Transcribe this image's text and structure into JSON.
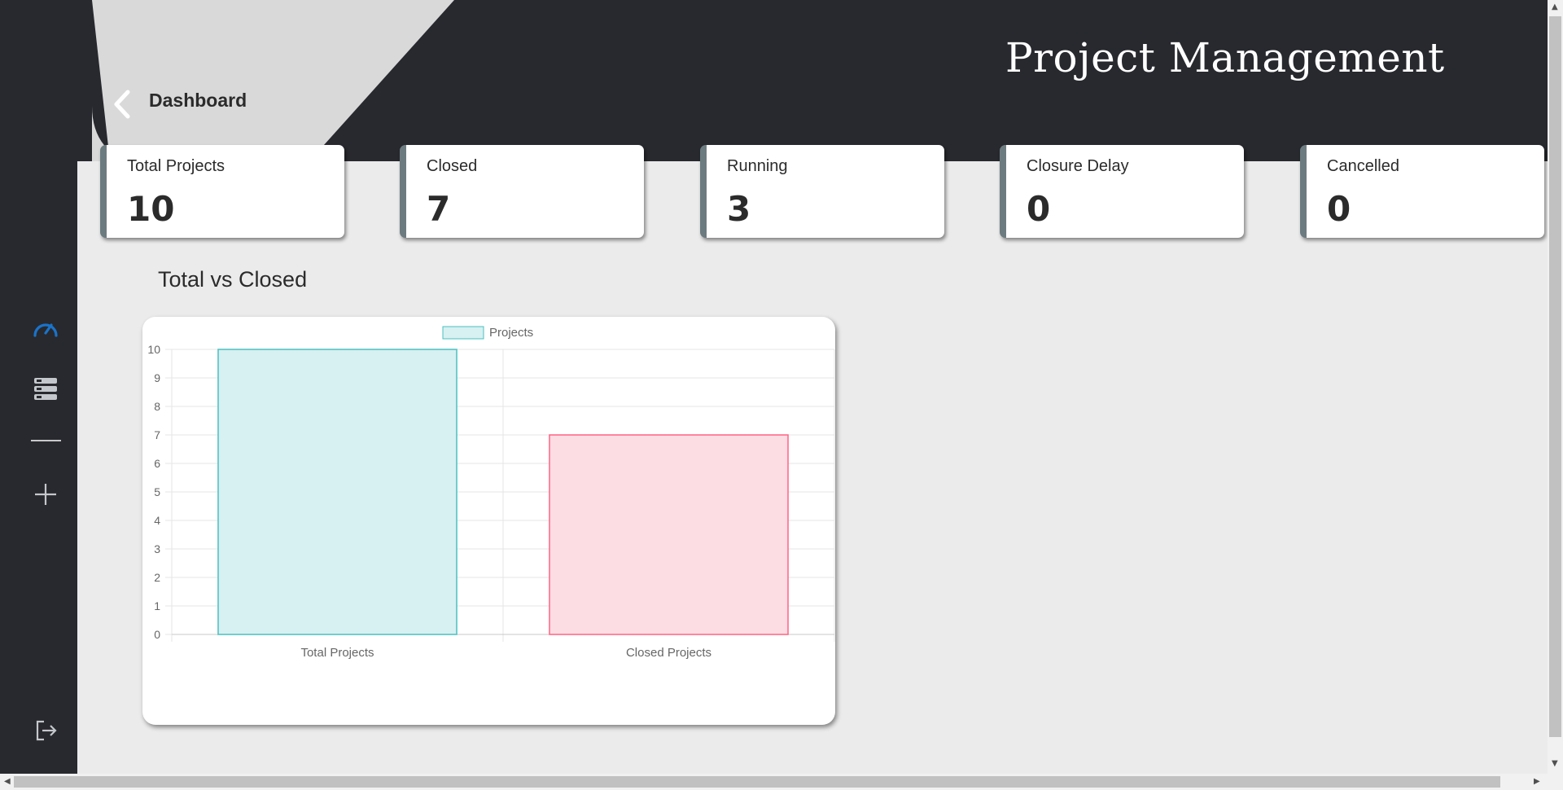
{
  "header": {
    "breadcrumb": "Dashboard",
    "title": "Project Management"
  },
  "sidebar": {
    "items": [
      {
        "name": "dashboard",
        "icon": "speedometer-icon",
        "active": true
      },
      {
        "name": "projects",
        "icon": "server-list-icon",
        "active": false
      },
      {
        "name": "add-project",
        "icon": "plus-icon",
        "active": false
      },
      {
        "name": "logout",
        "icon": "logout-icon",
        "active": false
      }
    ],
    "active_color": "#1a73c9"
  },
  "stats": [
    {
      "label": "Total Projects",
      "value": "10"
    },
    {
      "label": "Closed",
      "value": "7"
    },
    {
      "label": "Running",
      "value": "3"
    },
    {
      "label": "Closure Delay",
      "value": "0"
    },
    {
      "label": "Cancelled",
      "value": "0"
    }
  ],
  "chart_section": {
    "heading": "Total vs Closed"
  },
  "chart_data": {
    "type": "bar",
    "categories": [
      "Total Projects",
      "Closed Projects"
    ],
    "series": [
      {
        "name": "Projects",
        "values": [
          10,
          7
        ]
      }
    ],
    "bar_fills": [
      "#d7f0f1",
      "#fddde4"
    ],
    "bar_borders": [
      "#4bc0c0",
      "#ff6384"
    ],
    "ylim": [
      0,
      10
    ],
    "yticks": [
      "0",
      "1",
      "2",
      "3",
      "4",
      "5",
      "6",
      "7",
      "8",
      "9",
      "10"
    ],
    "grid": true,
    "legend_position": "top"
  }
}
